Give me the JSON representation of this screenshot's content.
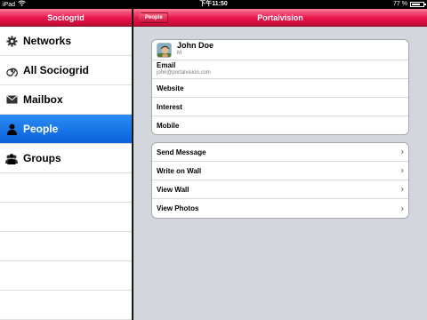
{
  "status_bar": {
    "device": "iPad",
    "time": "下午11:50",
    "battery": "77 %",
    "battery_level": 0.77
  },
  "left_panel": {
    "title": "Sociogrid",
    "items": [
      {
        "label": "Networks",
        "icon": "gear-icon"
      },
      {
        "label": "All Sociogrid",
        "icon": "spiral-icon"
      },
      {
        "label": "Mailbox",
        "icon": "envelope-icon"
      },
      {
        "label": "People",
        "icon": "person-icon",
        "selected": true
      },
      {
        "label": "Groups",
        "icon": "group-icon"
      }
    ]
  },
  "right_panel": {
    "title": "Portalvision",
    "back_button": "People",
    "profile": {
      "name": "John Doe",
      "gender": "M",
      "email_label": "Email",
      "email_value": "john@portalvision.com",
      "website_label": "Website",
      "interest_label": "Interest",
      "mobile_label": "Mobile"
    },
    "actions": [
      {
        "label": "Send Message"
      },
      {
        "label": "Write on Wall"
      },
      {
        "label": "View Wall"
      },
      {
        "label": "View Photos"
      }
    ]
  },
  "colors": {
    "nav_bar": "#e8144a",
    "selection": "#0a62dc",
    "detail_background": "#d3d6dc"
  }
}
